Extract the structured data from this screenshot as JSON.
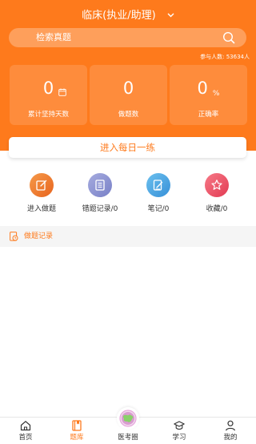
{
  "header": {
    "title": "临床(执业/助理)",
    "search_placeholder": "检索真题",
    "participants": "参与人数: 53634人"
  },
  "stats": [
    {
      "value": "0",
      "label": "累计坚持天数"
    },
    {
      "value": "0",
      "label": "做题数"
    },
    {
      "value": "0",
      "suffix": "%",
      "label": "正确率"
    }
  ],
  "daily_button": "进入每日一练",
  "menu": [
    {
      "label": "进入做题",
      "icon": "edit-icon",
      "color": "#f07a30"
    },
    {
      "label": "错题记录/0",
      "icon": "notebook-icon",
      "color": "#8e96d6"
    },
    {
      "label": "笔记/0",
      "icon": "note-pen-icon",
      "color": "#4aa7e3"
    },
    {
      "label": "收藏/0",
      "icon": "star-icon",
      "color": "#f0566a"
    }
  ],
  "record_section": "做题记录",
  "tabs": [
    {
      "label": "首页",
      "icon": "home-icon"
    },
    {
      "label": "题库",
      "icon": "question-bank-icon",
      "active": true
    },
    {
      "label": "医考圈",
      "icon": "globe-icon"
    },
    {
      "label": "学习",
      "icon": "graduation-cap-icon"
    },
    {
      "label": "我的",
      "icon": "user-icon"
    }
  ],
  "colors": {
    "accent": "#fe7a1c",
    "background": "#ffffff",
    "section_bg": "#f5f5f5"
  }
}
